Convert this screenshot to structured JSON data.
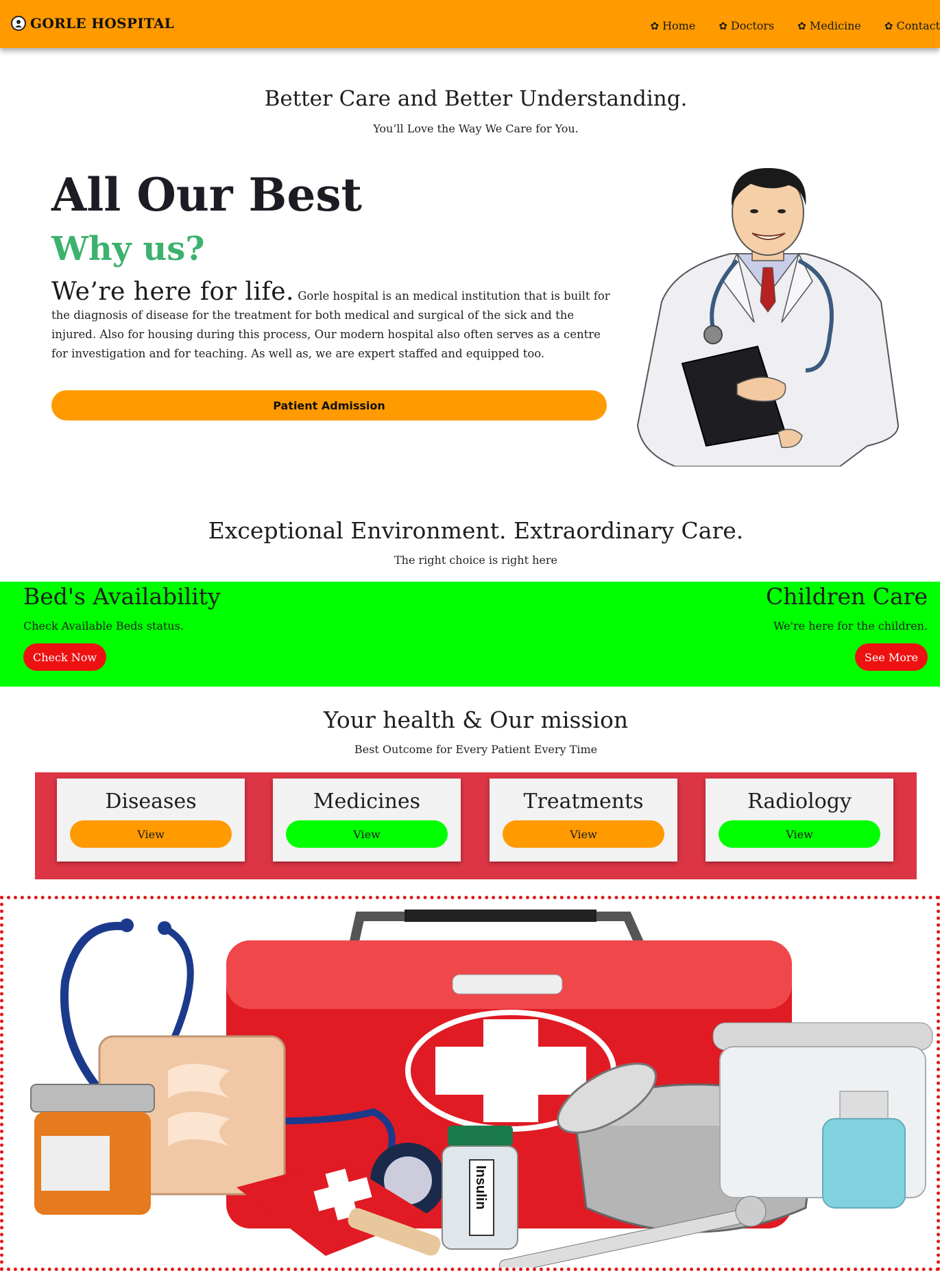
{
  "navbar": {
    "brand": "GORLE HOSPITAL",
    "links": [
      {
        "label": "Home"
      },
      {
        "label": "Doctors"
      },
      {
        "label": "Medicine"
      },
      {
        "label": "Contact"
      }
    ]
  },
  "hero": {
    "tagline": "Better Care and Better Understanding.",
    "subtagline": "You’ll Love the Way We Care for You.",
    "heading": "All Our Best",
    "subheading": "Why us?",
    "lead": "We’re here for life.",
    "body": "Gorle hospital is an medical institution that is built for the diagnosis of disease for the treatment for both medical and surgical of the sick and the injured. Also for housing during this process, Our modern hospital also often serves as a centre for investigation and for teaching. As well as, we are expert staffed and equipped too.",
    "button": "Patient Admission"
  },
  "environment": {
    "title": "Exceptional Environment. Extraordinary Care.",
    "subtitle": "The right choice is right here",
    "left": {
      "title": "Bed's Availability",
      "text": "Check Available Beds status.",
      "button": "Check Now"
    },
    "right": {
      "title": "Children Care",
      "text": "We're here for the children.",
      "button": "See More"
    }
  },
  "mission": {
    "title": "Your health & Our mission",
    "subtitle": "Best Outcome for Every Patient Every Time",
    "cards": [
      {
        "title": "Diseases",
        "button": "View"
      },
      {
        "title": "Medicines",
        "button": "View"
      },
      {
        "title": "Treatments",
        "button": "View"
      },
      {
        "title": "Radiology",
        "button": "View"
      }
    ]
  },
  "kit": {
    "insulin_label": "Insulin"
  },
  "colors": {
    "navbar": "#ff9a00",
    "accent_green": "#3db26e",
    "band_green": "#00ff00",
    "pill_red": "#ee1111",
    "crimson": "#dc3545"
  }
}
